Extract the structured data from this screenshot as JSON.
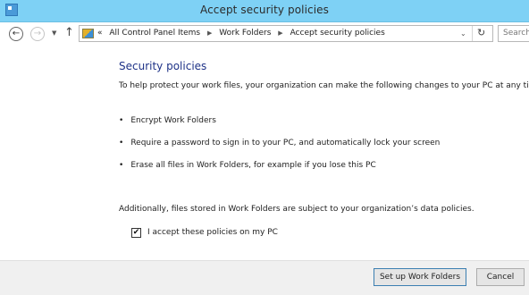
{
  "window": {
    "title": "Accept security policies",
    "icon": "control-panel-icon"
  },
  "nav": {
    "back_icon": "back-arrow-icon",
    "forward_icon": "forward-arrow-icon",
    "recent_icon": "chevron-down-icon",
    "up_icon": "up-arrow-icon"
  },
  "address": {
    "overflow": "«",
    "crumbs": [
      "All Control Panel Items",
      "Work Folders",
      "Accept security policies"
    ],
    "dropdown_icon": "chevron-down-icon",
    "refresh_icon": "refresh-icon"
  },
  "search": {
    "placeholder": "Search"
  },
  "content": {
    "heading": "Security policies",
    "intro": "To help protect your work files, your organization can make the following changes to your PC at any time:",
    "bullets": [
      "Encrypt Work Folders",
      "Require a password to sign in to your PC, and automatically lock your screen",
      "Erase all files in Work Folders, for example if you lose this PC"
    ],
    "additional": "Additionally, files stored in Work Folders are subject to your organization’s data policies.",
    "accept_label": "I accept these policies on my PC",
    "accept_checked": true
  },
  "footer": {
    "setup_label": "Set up Work Folders",
    "cancel_label": "Cancel"
  },
  "colors": {
    "titlebar": "#7ed1f5",
    "heading": "#1e3287"
  }
}
